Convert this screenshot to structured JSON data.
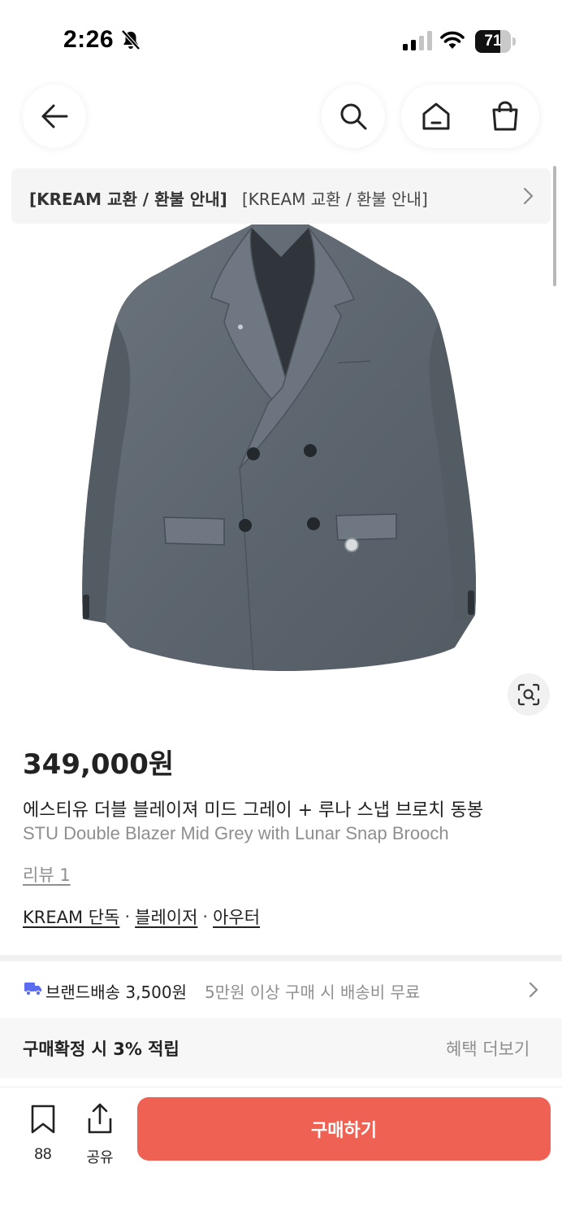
{
  "status_bar": {
    "time": "2:26",
    "battery": "71",
    "battery_level": 0.71
  },
  "nav": {
    "icons": [
      "back-arrow-icon",
      "search-icon",
      "home-icon",
      "shopping-bag-icon"
    ]
  },
  "notice": {
    "bold": "[KREAM 교환 / 환불 안내]",
    "light": "[KREAM 교환 / 환불 안내]"
  },
  "product": {
    "price": "349,000원",
    "name_ko": "에스티유 더블 블레이져 미드 그레이 + 루나 스냅 브로치 동봉",
    "name_en": "STU Double Blazer Mid Grey with Lunar Snap Brooch",
    "review": "리뷰 1",
    "tags": [
      "KREAM 단독",
      "블레이저",
      "아우터"
    ],
    "tag_separator": "·"
  },
  "shipping": {
    "strong": "브랜드배송 3,500원",
    "light": "5만원 이상 구매 시 배송비 무료"
  },
  "benefit": {
    "text": "구매확정 시 3% 적립",
    "more": "혜택 더보기"
  },
  "bottom_bar": {
    "bookmark_count": "88",
    "share_label": "공유",
    "buy_label": "구매하기"
  },
  "colors": {
    "accent": "#ef6253",
    "blazer": "#5d6770"
  }
}
